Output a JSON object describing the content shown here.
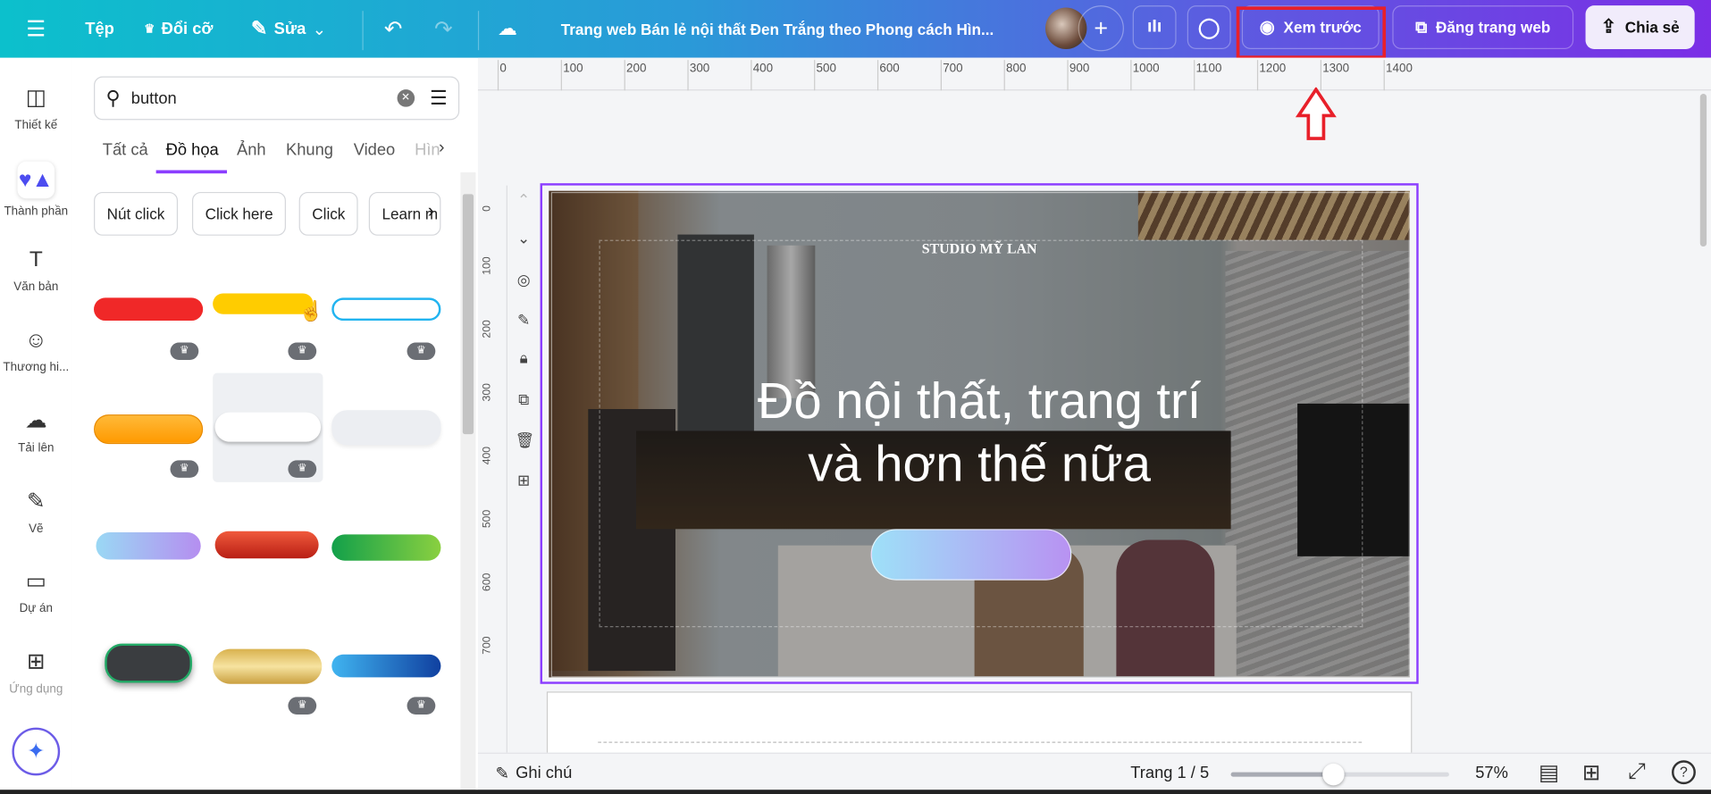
{
  "topbar": {
    "menu_icon": "hamburger-icon",
    "file": "Tệp",
    "resize": "Đổi cỡ",
    "edit": "Sửa",
    "title": "Trang web Bán lẻ nội thất Đen Trắng theo Phong cách Hìn...",
    "preview": "Xem trước",
    "publish": "Đăng trang web",
    "share": "Chia sẻ",
    "gradient": [
      "#0cc0cc",
      "#7b2ee6"
    ]
  },
  "rail": {
    "items": [
      {
        "label": "Thiết kế",
        "icon": "layout-icon"
      },
      {
        "label": "Thành phần",
        "icon": "elements-icon"
      },
      {
        "label": "Văn bản",
        "icon": "text-icon"
      },
      {
        "label": "Thương hi...",
        "icon": "brand-icon"
      },
      {
        "label": "Tải lên",
        "icon": "upload-icon"
      },
      {
        "label": "Vẽ",
        "icon": "draw-icon"
      },
      {
        "label": "Dự án",
        "icon": "folder-icon"
      },
      {
        "label": "Ứng dụng",
        "icon": "apps-icon"
      }
    ]
  },
  "panel": {
    "search_value": "button",
    "tabs": [
      "Tất cả",
      "Đồ họa",
      "Ảnh",
      "Khung",
      "Video",
      "Hìn"
    ],
    "active_tab": "Đồ họa",
    "chips": [
      "Nút click",
      "Click here",
      "Click",
      "Learn m"
    ]
  },
  "ruler": {
    "h": [
      "0",
      "100",
      "200",
      "300",
      "400",
      "500",
      "600",
      "700",
      "800",
      "900",
      "1000",
      "1100",
      "1200",
      "1300",
      "1400"
    ],
    "v": [
      "0",
      "100",
      "200",
      "300",
      "400",
      "500",
      "600",
      "700"
    ]
  },
  "design": {
    "brand": "STUDIO MỸ LAN",
    "headline_1": "Đồ nội thất, trang trí",
    "headline_2": "và hơn thế nữa"
  },
  "bottombar": {
    "notes": "Ghi chú",
    "page": "Trang 1 / 5",
    "zoom": "57%",
    "zoom_percent": 57
  },
  "highlight_color": "#e8202a",
  "accent": "#8b3dff"
}
